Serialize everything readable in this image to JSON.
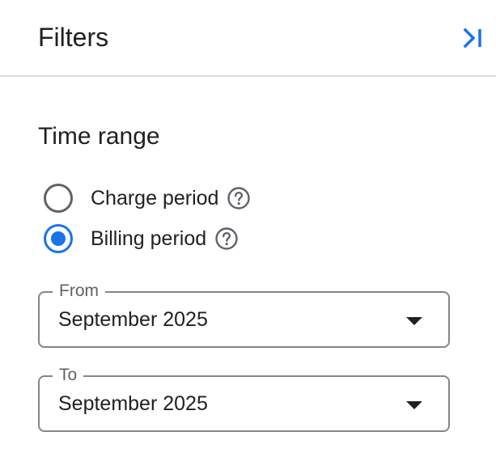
{
  "header": {
    "title": "Filters",
    "collapse_icon": "collapse-panel-icon"
  },
  "time_range": {
    "title": "Time range",
    "options": [
      {
        "label": "Charge period",
        "selected": false
      },
      {
        "label": "Billing period",
        "selected": true
      }
    ],
    "from": {
      "label": "From",
      "value": "September 2025"
    },
    "to": {
      "label": "To",
      "value": "September 2025"
    }
  },
  "colors": {
    "accent": "#1a73e8",
    "text": "#202124",
    "border": "#80868b",
    "divider": "#dadce0"
  }
}
